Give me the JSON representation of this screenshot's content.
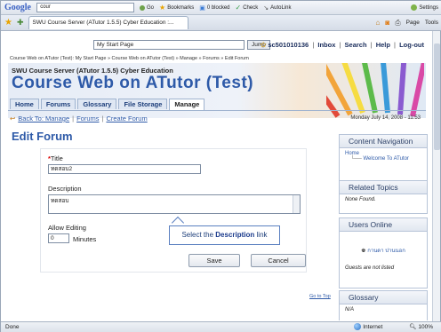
{
  "browser": {
    "google_logo": "Google",
    "search_value": " cour",
    "go_label": "Go",
    "bookmarks_label": "Bookmarks",
    "blocked_label": "0 blocked",
    "check_label": "Check",
    "autolink_label": "AutoLink",
    "settings_label": "Settings",
    "tab_title": "SWU Course Server (ATutor 1.5.5) Cyber Education :...",
    "page_menu": "Page",
    "tools_menu": "Tools",
    "status_left": "Done",
    "status_zone": "Internet",
    "zoom": "100%"
  },
  "header": {
    "jump_select": "My Start Page",
    "jump_button": "Jump",
    "user": "sc501010136",
    "links": [
      "Inbox",
      "Search",
      "Help",
      "Log-out"
    ],
    "breadcrumb": "Course Web on ATutor (Test): My Start Page » Course Web on ATutor (Test) » Manage » Forums » Edit Forum",
    "site_name": "SWU Course Server (ATutor 1.5.5) Cyber Education",
    "course_title": "Course Web on ATutor (Test)",
    "tabs": [
      "Home",
      "Forums",
      "Glossary",
      "File Storage",
      "Manage"
    ]
  },
  "subnav": {
    "back": "Back To: Manage",
    "forums": "Forums",
    "create": "Create Forum",
    "date": "Monday July 14, 2008 - 11:53"
  },
  "form": {
    "heading": "Edit Forum",
    "title_label": "Title",
    "title_value": "ทดสอบ2",
    "description_label": "Description",
    "description_value": "ทดสอบ",
    "allow_editing_label": "Allow Editing",
    "allow_editing_value": "0",
    "minutes_label": "Minutes",
    "save": "Save",
    "cancel": "Cancel"
  },
  "tooltip": {
    "prefix": "Select the",
    "bold": "Description",
    "suffix": "link"
  },
  "goto_top": "Go to Top",
  "sidebar": {
    "content_nav": {
      "title": "Content Navigation",
      "home": "Home",
      "welcome": "Welcome To ATutor"
    },
    "related": {
      "title": "Related Topics",
      "body": "None Found."
    },
    "users_online": {
      "title": "Users Online",
      "user": "กานดา ปานนอก",
      "guests": "Guests are not listed"
    },
    "glossary": {
      "title": "Glossary",
      "body": "N/A"
    }
  },
  "colors": {
    "accent": "#2e5aa8",
    "required": "#dd0000"
  }
}
